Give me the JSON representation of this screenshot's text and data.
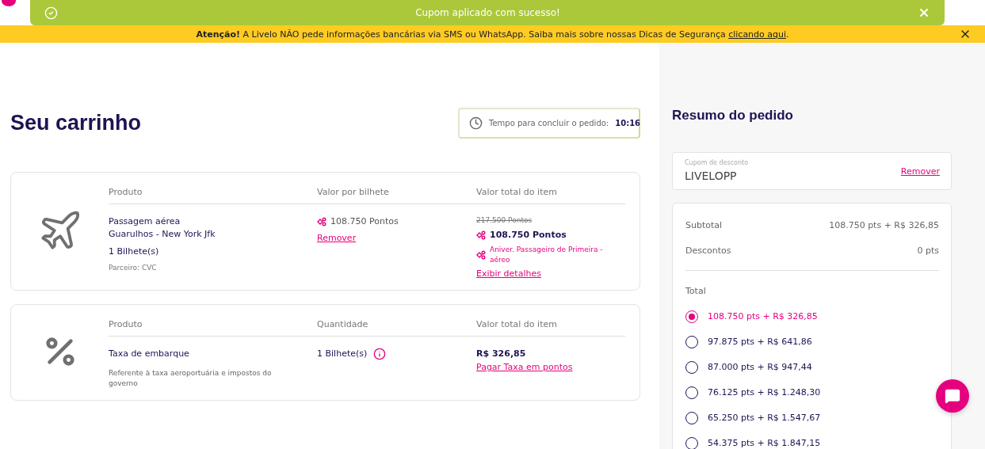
{
  "toast": {
    "message": "Cupom aplicado com sucesso!"
  },
  "banner": {
    "text": "**Atenção!** A Livelo NÃO pede informações bancárias via SMS ou WhatsApp. Saiba mais sobre nossas Dicas de Segurança",
    "link": "clicando aqui",
    "end": "."
  },
  "cart": {
    "title": "Seu carrinho",
    "timer": {
      "label": "Tempo para concluir o pedido:",
      "value": "10:16"
    },
    "items": [
      {
        "kind": "flight",
        "columns": [
          "Produto",
          "Valor por bilhete",
          "Valor total do item"
        ],
        "product": [
          "Passagem aérea",
          "Guarulhos - New York Jfk"
        ],
        "tickets": "1 Bilhete(s)",
        "partner": "Parceiro: CVC",
        "unit_price": "108.750 Pontos",
        "remove": "Remover",
        "old_total": "217.500 Pontos",
        "total": "108.750 Pontos",
        "promo": "Aniver. Passageiro de Primeira - aéreo",
        "details": "Exibir detalhes"
      },
      {
        "kind": "fee",
        "columns": [
          "Produto",
          "Quantidade",
          "Valor total do item"
        ],
        "product": [
          "Taxa de embarque"
        ],
        "description": "Referente à taxa aeroportuária e impostos do governo",
        "quantity": "1 Bilhete(s)",
        "total": "R$ 326,85",
        "action": "Pagar Taxa em pontos"
      }
    ]
  },
  "summary": {
    "title": "Resumo do pedido",
    "coupon": {
      "label": "Cupom de desconto",
      "value": "LIVELOPP",
      "action": "Remover"
    },
    "rows": [
      {
        "label": "Subtotal",
        "value": "108.750 pts + R$ 326,85"
      },
      {
        "label": "Descontos",
        "value": "0 pts"
      }
    ],
    "total_label": "Total",
    "options": [
      {
        "label": "108.750 pts + R$ 326,85",
        "selected": true
      },
      {
        "label": "97.875 pts + R$ 641,86",
        "selected": false
      },
      {
        "label": "87.000 pts + R$ 947,44",
        "selected": false
      },
      {
        "label": "76.125 pts + R$ 1.248,30",
        "selected": false
      },
      {
        "label": "65.250 pts + R$ 1.547,67",
        "selected": false
      },
      {
        "label": "54.375 pts + R$ 1.847,15",
        "selected": false
      }
    ]
  }
}
